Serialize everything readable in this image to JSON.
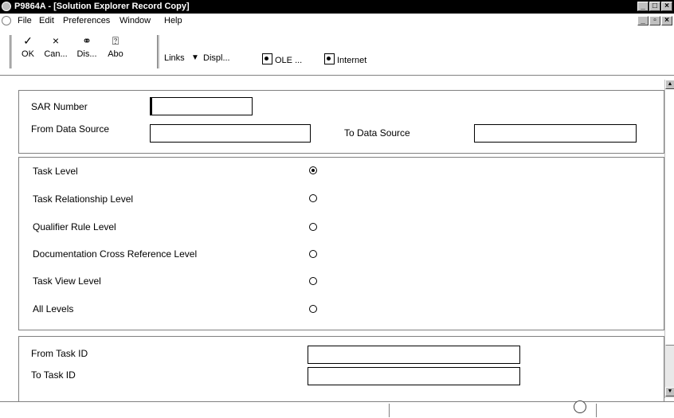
{
  "window": {
    "title": "P9864A - [Solution Explorer Record Copy]"
  },
  "menu": {
    "items": [
      "File",
      "Edit",
      "Preferences",
      "Window",
      "Help"
    ]
  },
  "toolbar": {
    "ok_label": "OK",
    "cancel_label": "Can...",
    "display_label": "Dis...",
    "about_label": "Abo",
    "links_label": "Links",
    "display_menu_label": "Displ...",
    "ole_label": "OLE ...",
    "internet_label": "Internet"
  },
  "header": {
    "sar_number_label": "SAR Number",
    "sar_number_value": "",
    "from_data_source_label": "From Data Source",
    "from_data_source_value": "",
    "to_data_source_label": "To Data Source",
    "to_data_source_value": ""
  },
  "levels": {
    "selected": "Task Level",
    "options": [
      "Task Level",
      "Task Relationship Level",
      "Qualifier Rule Level",
      "Documentation Cross Reference Level",
      "Task View Level",
      "All Levels"
    ]
  },
  "task_range": {
    "from_label": "From Task ID",
    "from_value": "",
    "to_label": "To Task ID",
    "to_value": ""
  }
}
